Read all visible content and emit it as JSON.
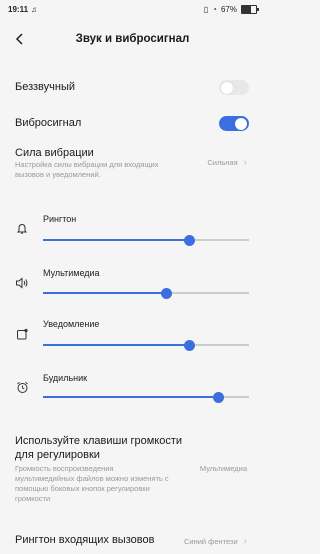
{
  "statusbar": {
    "time": "19:11",
    "battery": "67%",
    "battery_level": 0.67
  },
  "header": {
    "title": "Звук и вибросигнал"
  },
  "silent": {
    "label": "Беззвучный",
    "on": false
  },
  "vibration": {
    "label": "Вибросигнал",
    "on": true
  },
  "vibration_strength": {
    "title": "Сила вибрации",
    "desc_line1": "Настройка силы вибрации для входящих",
    "desc_line2": "вызовов и уведомлений.",
    "value": "Сильная"
  },
  "volumes": [
    {
      "label": "Рингтон",
      "icon": "bell-icon",
      "level": 0.71
    },
    {
      "label": "Мультимедиа",
      "icon": "speaker-icon",
      "level": 0.6
    },
    {
      "label": "Уведомление",
      "icon": "notification-icon",
      "level": 0.71
    },
    {
      "label": "Будильник",
      "icon": "alarm-icon",
      "level": 0.85
    }
  ],
  "volume_keys": {
    "title_line1": "Используйте клавиши громкости",
    "title_line2": "для регулировки",
    "desc_line1": "Громкость воспроизведения",
    "desc_line2": "мультимедийных файлов можно изменять с",
    "desc_line3": "помощью боковых кнопок регулировки",
    "desc_line4": "громкости",
    "value": "Мультимедиа"
  },
  "ringtone": {
    "title": "Рингтон входящих вызовов",
    "value": "Синий фентези"
  }
}
